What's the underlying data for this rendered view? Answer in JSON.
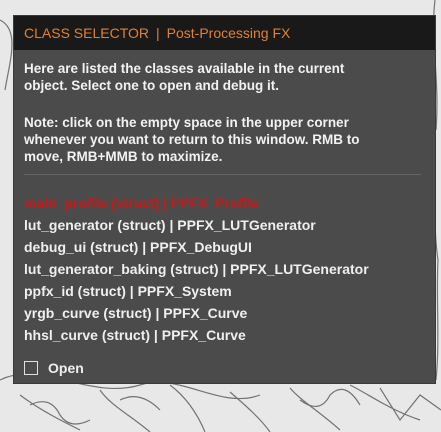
{
  "window": {
    "title_left": "CLASS SELECTOR",
    "title_sep": "|",
    "title_right": "Post-Processing FX",
    "accent_color": "#e3802f"
  },
  "intro": "Here are listed the classes available in the current\nobject. Select one to open and debug it.",
  "note": "Note: click on the empty space in the upper corner\nwhenever you want to return to this window. RMB to\nmove, RMB+MMB to maximize.",
  "classes": [
    {
      "label": "main_profile (struct) | PPFX_Profile",
      "selected": true
    },
    {
      "label": "lut_generator (struct) | PPFX_LUTGenerator"
    },
    {
      "label": "debug_ui (struct) | PPFX_DebugUI"
    },
    {
      "label": "lut_generator_baking (struct) | PPFX_LUTGenerator"
    },
    {
      "label": "ppfx_id (struct) | PPFX_System"
    },
    {
      "label": "yrgb_curve (struct) | PPFX_Curve"
    },
    {
      "label": "hhsl_curve (struct) | PPFX_Curve"
    }
  ],
  "open_checkbox": {
    "label": "Open",
    "checked": false
  },
  "selected_color": "#d01515"
}
